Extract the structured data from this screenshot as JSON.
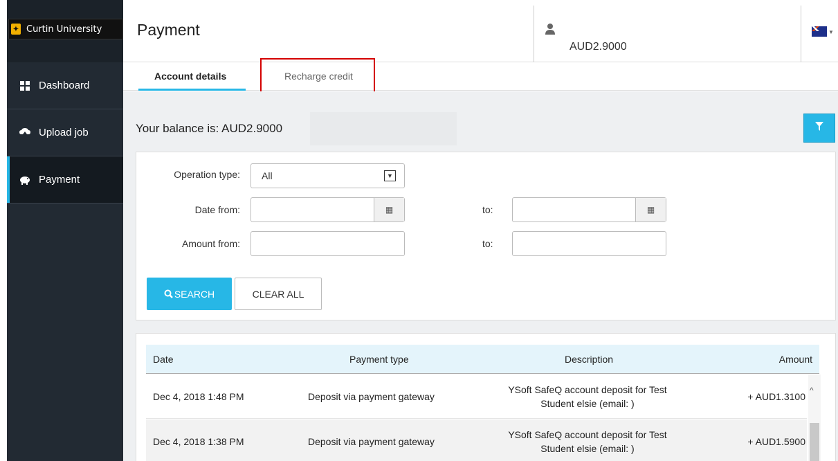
{
  "sidebar": {
    "brand": "Curtin University",
    "items": [
      {
        "label": "Dashboard",
        "icon": "grid-icon"
      },
      {
        "label": "Upload job",
        "icon": "cloud-upload-icon"
      },
      {
        "label": "Payment",
        "icon": "piggy-bank-icon"
      }
    ],
    "active": "Payment"
  },
  "header": {
    "title": "Payment",
    "balance": "AUD2.9000",
    "language_flag": "australia-flag-icon"
  },
  "tabs": [
    {
      "label": "Account details",
      "active": true
    },
    {
      "label": "Recharge credit",
      "active": false
    }
  ],
  "main": {
    "balance_text": "Your balance is: AUD2.9000"
  },
  "filters": {
    "operation_type_label": "Operation type:",
    "operation_type_value": "All",
    "date_from_label": "Date from:",
    "date_to_label": "to:",
    "amount_from_label": "Amount from:",
    "amount_to_label": "to:",
    "search_label": "SEARCH",
    "clear_label": "CLEAR ALL"
  },
  "table": {
    "columns": [
      "Date",
      "Payment type",
      "Description",
      "Amount"
    ],
    "rows": [
      {
        "date": "Dec 4, 2018 1:48 PM",
        "type": "Deposit via payment gateway",
        "desc1": "YSoft SafeQ account deposit for Test",
        "desc2": "Student elsie (email: )",
        "amount": "+ AUD1.3100"
      },
      {
        "date": "Dec 4, 2018 1:38 PM",
        "type": "Deposit via payment gateway",
        "desc1": "YSoft SafeQ account deposit for Test",
        "desc2": "Student elsie (email: )",
        "amount": "+ AUD1.5900"
      }
    ]
  },
  "colors": {
    "accent": "#27b7e6",
    "sidebar": "#222a33",
    "highlight": "#d40000"
  }
}
